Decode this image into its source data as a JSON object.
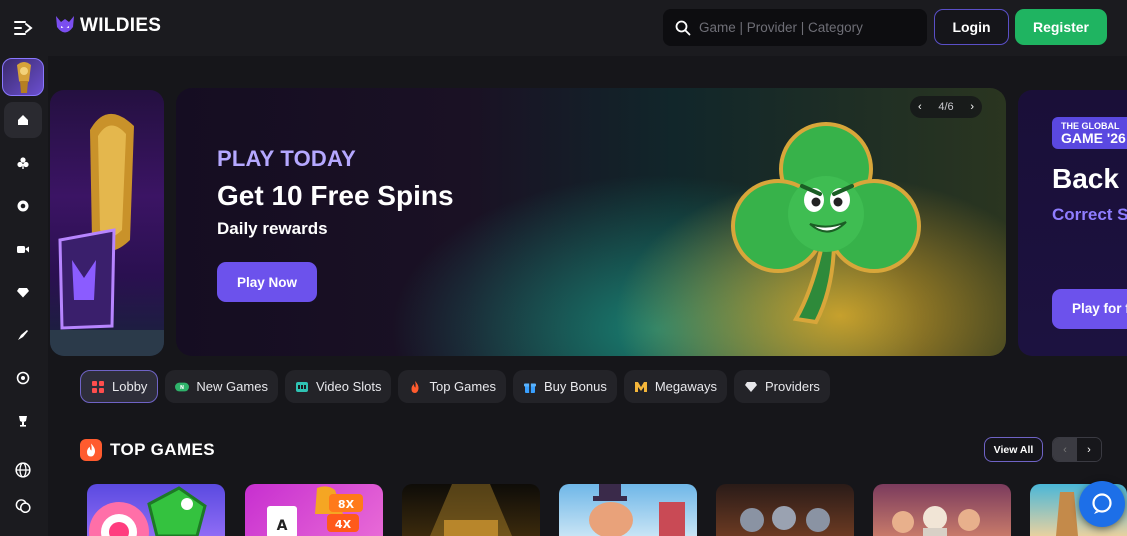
{
  "header": {
    "brand": "WILDIES",
    "search_placeholder": "Game | Provider | Category",
    "login_label": "Login",
    "register_label": "Register"
  },
  "sidebar": {
    "items": [
      {
        "icon": "home-icon"
      },
      {
        "icon": "cards-icon"
      },
      {
        "icon": "casino-chip-icon"
      },
      {
        "icon": "live-camera-icon"
      },
      {
        "icon": "diamond-icon"
      },
      {
        "icon": "rocket-icon"
      },
      {
        "icon": "target-icon"
      },
      {
        "icon": "trophy-icon"
      },
      {
        "icon": "globe-icon"
      },
      {
        "icon": "chat-bubbles-icon"
      }
    ]
  },
  "banner": {
    "kicker": "PLAY TODAY",
    "title": "Get 10 Free Spins",
    "subtitle": "Daily rewards",
    "cta_label": "Play Now",
    "pager": "4/6",
    "next_slide": {
      "badge_line1": "THE GLOBAL",
      "badge_line2": "GAME '26",
      "title": "Back",
      "subtitle": "Correct S",
      "cta_label": "Play for f"
    }
  },
  "categories": [
    {
      "label": "Lobby",
      "icon": "lobby-icon",
      "active": true
    },
    {
      "label": "New Games",
      "icon": "new-badge-icon",
      "active": false
    },
    {
      "label": "Video Slots",
      "icon": "slot-machine-icon",
      "active": false
    },
    {
      "label": "Top Games",
      "icon": "fire-icon",
      "active": false
    },
    {
      "label": "Buy Bonus",
      "icon": "gift-icon",
      "active": false
    },
    {
      "label": "Megaways",
      "icon": "megaways-icon",
      "active": false
    },
    {
      "label": "Providers",
      "icon": "providers-icon",
      "active": false
    }
  ],
  "top_games": {
    "title": "TOP GAMES",
    "view_all_label": "View All",
    "prev_arrow": "‹",
    "next_arrow": "›",
    "tiles": [
      {
        "theme": "candy",
        "text1": "",
        "text2": ""
      },
      {
        "theme": "multiplier",
        "text1": "8X",
        "text2": "4X",
        "text3": "A"
      },
      {
        "theme": "spotlight"
      },
      {
        "theme": "cartoon-character"
      },
      {
        "theme": "dark-warriors"
      },
      {
        "theme": "gods"
      },
      {
        "theme": "beach"
      }
    ]
  },
  "colors": {
    "accent": "#6c52ec",
    "register": "#1fb461",
    "chat": "#1d6fe8",
    "background": "#16161a",
    "panel": "#1b1b1f"
  }
}
